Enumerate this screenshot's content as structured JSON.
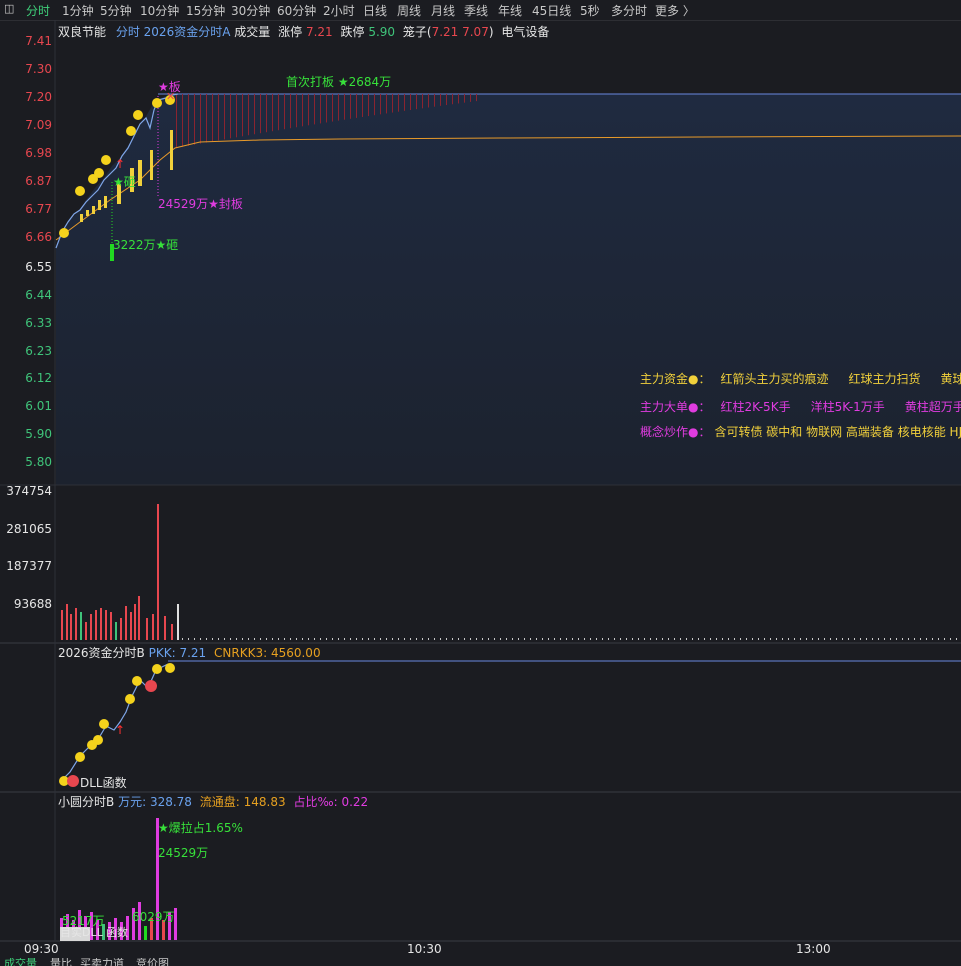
{
  "tabbar": {
    "tabs": [
      "分时",
      "1分钟",
      "5分钟",
      "10分钟",
      "15分钟",
      "30分钟",
      "60分钟",
      "2小时",
      "日线",
      "周线",
      "月线",
      "季线",
      "年线",
      "45日线",
      "5秒",
      "多分时",
      "更多 〉"
    ]
  },
  "header": {
    "stock": "双良节能",
    "formula": "分时 2026资金分时A",
    "volume_label": "成交量",
    "limit_up_label": "涨停",
    "limit_up": "7.21",
    "limit_down_label": "跌停",
    "limit_down": "5.90",
    "basket_label": "笼子(",
    "basket_v1": "7.21",
    "basket_v2": "7.07",
    "basket_close": ")",
    "sector": "电气设备"
  },
  "price_axis": {
    "up": [
      "7.41",
      "7.30",
      "7.20",
      "7.09",
      "6.98",
      "6.87",
      "6.77",
      "6.66"
    ],
    "mid": "6.55",
    "down": [
      "6.44",
      "6.33",
      "6.23",
      "6.12",
      "6.01",
      "5.90",
      "5.80"
    ]
  },
  "annotations": {
    "first_board": "首次打板 ★2684万",
    "board_star": "★板",
    "smash_star": "★砸",
    "seal": "24529万★封板",
    "smash_amt": "3222万★砸"
  },
  "legend": {
    "row1": [
      "主力资金●：",
      "红箭头主力买的痕迹",
      "红球主力扫货",
      "黄球"
    ],
    "row2": [
      "主力大单●：",
      "红柱2K-5K手",
      "洋柱5K-1万手",
      "黄柱超万手"
    ],
    "row3_title": "概念炒作●：",
    "row3_items": "含可转债 碳中和 物联网 高端装备 核电核能 HJT"
  },
  "volume_axis": [
    "374754",
    "281065",
    "187377",
    "93688"
  ],
  "panel2": {
    "title": "2026资金分时B",
    "pkk_label": "PKK:",
    "pkk": "7.21",
    "cnrkk_label": "CNRKK3:",
    "cnrkk": "4560.00",
    "dll": "DLL函数"
  },
  "panel3": {
    "title": "小圆分时B",
    "wan_label": "万元:",
    "wan": "328.78",
    "float_label": "流通盘:",
    "float": "148.83",
    "ratio_label": "占比‰:",
    "ratio": "0.22",
    "burst": "★爆拉占1.65%",
    "burst_amt": "24529万",
    "amt1": "5217万",
    "amt2": "6029万",
    "small1": "目实DLL",
    "small2": "函数"
  },
  "time_axis": [
    "09:30",
    "10:30",
    "13:00"
  ],
  "bottom_tabs": [
    "成交量",
    "量比",
    "买卖力道",
    "竞价图"
  ],
  "chart_data": {
    "type": "line",
    "price_points": [
      6.6,
      6.63,
      6.68,
      6.7,
      6.72,
      6.75,
      6.8,
      6.85,
      6.88,
      6.91,
      6.93,
      6.9,
      6.95,
      6.98,
      7.05,
      7.1,
      7.15,
      7.18,
      7.12,
      7.19,
      7.21
    ],
    "limit_price": 7.21,
    "avg_end": 7.05,
    "volume_peak": 340000
  },
  "colors": {
    "bg": "#1b1c21",
    "price_line": "#7fa6e8",
    "avg_line": "#e89a2a",
    "limit": "#6a88e0",
    "ball": "#f4d21c"
  }
}
